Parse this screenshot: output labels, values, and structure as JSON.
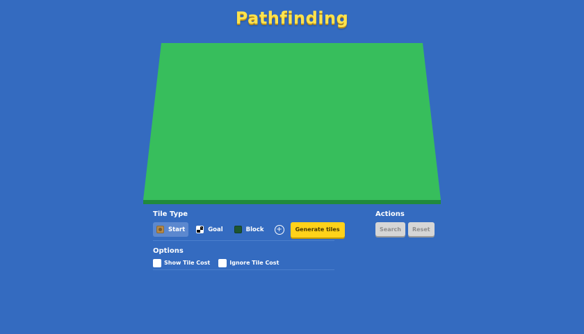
{
  "header": {
    "title": "Pathfinding"
  },
  "colors": {
    "background": "#346bc0",
    "title": "#ffe34d",
    "board_top": "#37be5c",
    "board_edge": "#208a3d",
    "accent_button": "#ffd21a",
    "disabled_button": "#d6d6d6"
  },
  "tile_type": {
    "label": "Tile Type",
    "options": [
      {
        "label": "Start",
        "icon": "start-tile-icon",
        "selected": true
      },
      {
        "label": "Goal",
        "icon": "goal-tile-icon",
        "selected": false
      },
      {
        "label": "Block",
        "icon": "block-tile-icon",
        "selected": false
      }
    ],
    "add_icon": "plus-circle-icon",
    "generate_label": "Generate tiles"
  },
  "options": {
    "label": "Options",
    "show_tile_cost": {
      "label": "Show Tile Cost",
      "checked": false
    },
    "ignore_tile_cost": {
      "label": "Ignore Tile Cost",
      "checked": false
    }
  },
  "actions": {
    "label": "Actions",
    "search_label": "Search",
    "reset_label": "Reset"
  }
}
